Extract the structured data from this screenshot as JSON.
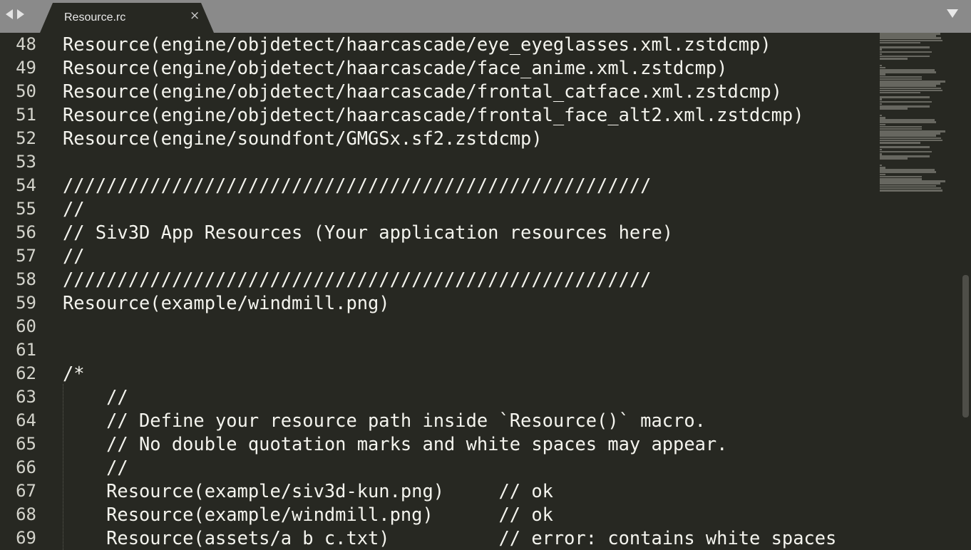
{
  "tabbar": {
    "back_icon": "chevron-left-icon",
    "forward_icon": "chevron-right-icon",
    "tab": {
      "title": "Resource.rc",
      "close_glyph": "×"
    },
    "menu_icon": "triangle-down-icon"
  },
  "editor": {
    "colors": {
      "background": "#272822",
      "text": "#f4f4ee",
      "gutter_text": "#d4d4cc",
      "tabbar": "#8a8a8a"
    },
    "lines": [
      {
        "number": "48",
        "text": "Resource(engine/objdetect/haarcascade/eye_eyeglasses.xml.zstdcmp)"
      },
      {
        "number": "49",
        "text": "Resource(engine/objdetect/haarcascade/face_anime.xml.zstdcmp)"
      },
      {
        "number": "50",
        "text": "Resource(engine/objdetect/haarcascade/frontal_catface.xml.zstdcmp)"
      },
      {
        "number": "51",
        "text": "Resource(engine/objdetect/haarcascade/frontal_face_alt2.xml.zstdcmp)"
      },
      {
        "number": "52",
        "text": "Resource(engine/soundfont/GMGSx.sf2.zstdcmp)"
      },
      {
        "number": "53",
        "text": ""
      },
      {
        "number": "54",
        "text": "//////////////////////////////////////////////////////"
      },
      {
        "number": "55",
        "text": "//"
      },
      {
        "number": "56",
        "text": "// Siv3D App Resources (Your application resources here)"
      },
      {
        "number": "57",
        "text": "//"
      },
      {
        "number": "58",
        "text": "//////////////////////////////////////////////////////"
      },
      {
        "number": "59",
        "text": "Resource(example/windmill.png)"
      },
      {
        "number": "60",
        "text": ""
      },
      {
        "number": "61",
        "text": ""
      },
      {
        "number": "62",
        "text": "/*"
      },
      {
        "number": "63",
        "text": "    //"
      },
      {
        "number": "64",
        "text": "    // Define your resource path inside `Resource()` macro."
      },
      {
        "number": "65",
        "text": "    // No double quotation marks and white spaces may appear."
      },
      {
        "number": "66",
        "text": "    //"
      },
      {
        "number": "67",
        "text": "    Resource(example/siv3d-kun.png)     // ok"
      },
      {
        "number": "68",
        "text": "    Resource(example/windmill.png)      // ok"
      },
      {
        "number": "69",
        "text": "    Resource(assets/a b c.txt)          // error: contains white spaces"
      }
    ]
  }
}
